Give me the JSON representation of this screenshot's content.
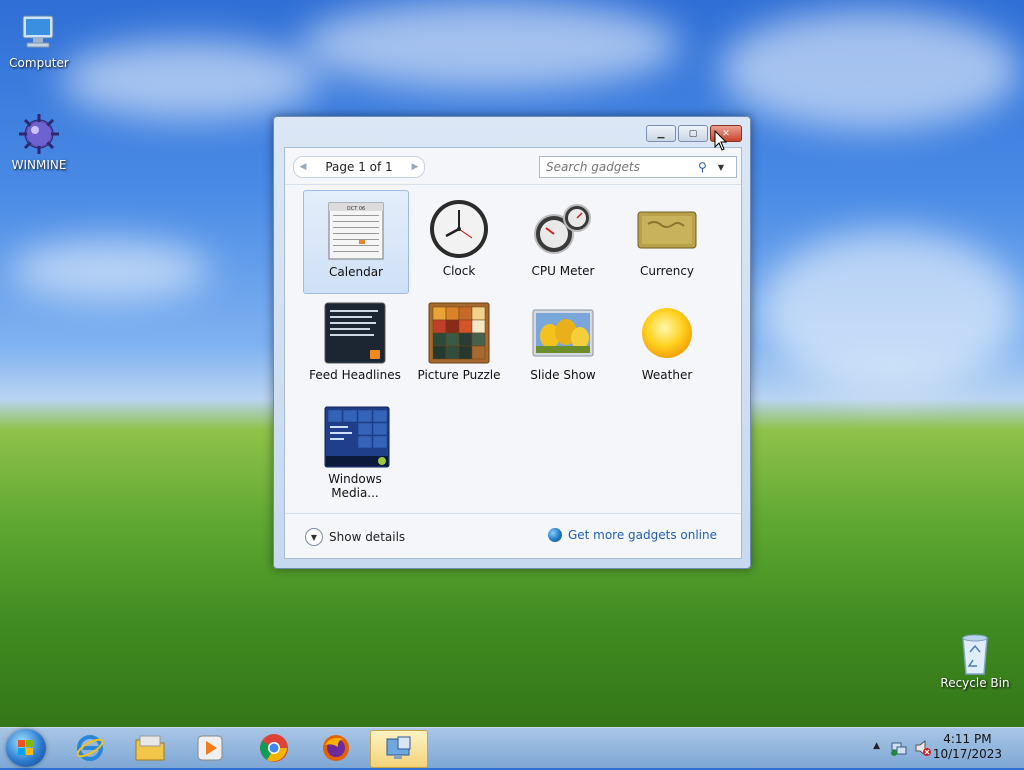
{
  "desktop": {
    "icons": [
      {
        "label": "Computer"
      },
      {
        "label": "WINMINE"
      },
      {
        "label": "Recycle Bin"
      }
    ]
  },
  "gadget_window": {
    "pager_label": "Page 1 of 1",
    "search_placeholder": "Search gadgets",
    "gadgets": [
      {
        "label": "Calendar",
        "icon": "calendar-icon",
        "selected": true
      },
      {
        "label": "Clock",
        "icon": "clock-icon"
      },
      {
        "label": "CPU Meter",
        "icon": "cpu-meter-icon"
      },
      {
        "label": "Currency",
        "icon": "currency-icon"
      },
      {
        "label": "Feed Headlines",
        "icon": "feed-headlines-icon"
      },
      {
        "label": "Picture Puzzle",
        "icon": "picture-puzzle-icon"
      },
      {
        "label": "Slide Show",
        "icon": "slide-show-icon"
      },
      {
        "label": "Weather",
        "icon": "weather-icon"
      },
      {
        "label": "Windows Media...",
        "icon": "windows-media-icon"
      }
    ],
    "calendar_month_label": "OCT 06",
    "footer": {
      "show_details": "Show details",
      "get_more": "Get more gadgets online"
    }
  },
  "taskbar": {
    "apps": [
      "internet-explorer-icon",
      "file-explorer-icon",
      "media-player-icon",
      "chrome-icon",
      "firefox-icon",
      "gadgets-icon"
    ],
    "clock": {
      "time": "4:11 PM",
      "date": "10/17/2023"
    }
  },
  "colors": {
    "link": "#1f5fae",
    "selection": "#cfe0f6",
    "close_button": "#c8452f"
  }
}
